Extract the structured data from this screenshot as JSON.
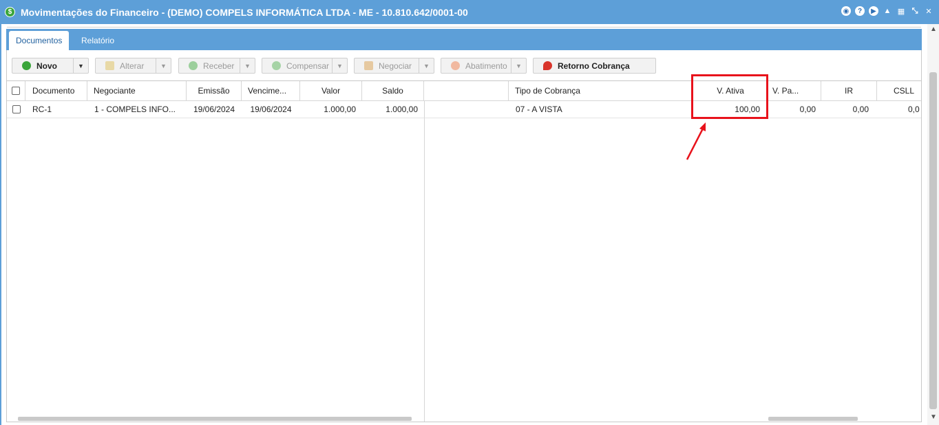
{
  "window": {
    "title": "Movimentações do Financeiro - (DEMO) COMPELS INFORMÁTICA LTDA - ME - 10.810.642/0001-00",
    "app_icon": "dollar-icon",
    "title_tools": [
      "eye-icon",
      "help-icon",
      "play-icon",
      "bell-icon",
      "calendar-icon",
      "collapse-icon",
      "close-icon"
    ]
  },
  "tabs": [
    {
      "label": "Documentos",
      "active": true
    },
    {
      "label": "Relatório",
      "active": false
    }
  ],
  "toolbar": {
    "novo": "Novo",
    "alterar": "Alterar",
    "receber": "Receber",
    "compensar": "Compensar",
    "negociar": "Negociar",
    "abatimento": "Abatimento",
    "retorno": "Retorno Cobrança"
  },
  "table": {
    "columns": {
      "documento": "Documento",
      "negociante": "Negociante",
      "emissao": "Emissão",
      "vencimento": "Vencime...",
      "valor": "Valor",
      "saldo": "Saldo",
      "tipo_cobranca": "Tipo de Cobrança",
      "v_ativa": "V. Ativa",
      "v_passiva": "V. Pa...",
      "ir": "IR",
      "csll": "CSLL"
    },
    "rows": [
      {
        "documento": "RC-1",
        "negociante": "1 - COMPELS INFO...",
        "emissao": "19/06/2024",
        "vencimento": "19/06/2024",
        "valor": "1.000,00",
        "saldo": "1.000,00",
        "tipo_cobranca": "07 - A VISTA",
        "v_ativa": "100,00",
        "v_passiva": "0,00",
        "ir": "0,00",
        "csll": "0,0"
      }
    ]
  },
  "colors": {
    "titlebar": "#5d9fd8",
    "highlight": "#e8121b",
    "active_tab_text": "#1e5f9e"
  }
}
